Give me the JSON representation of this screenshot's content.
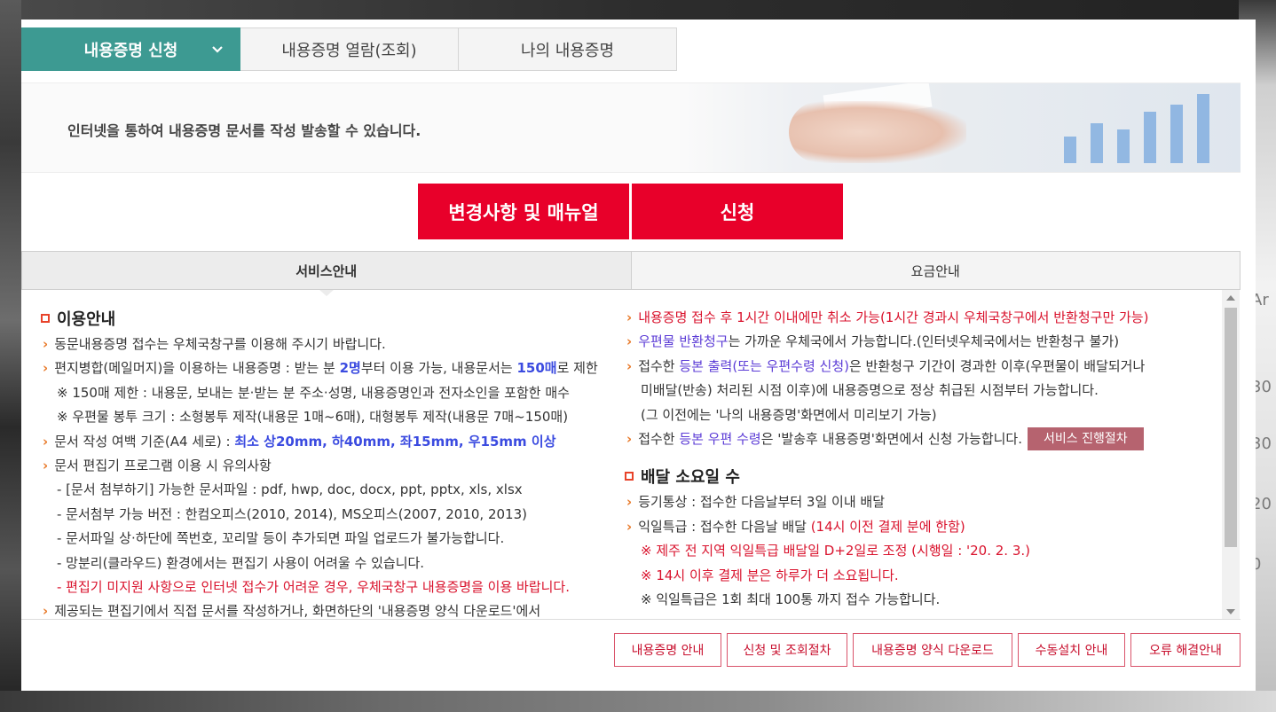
{
  "top_tabs": [
    {
      "label": "내용증명 신청"
    },
    {
      "label": "내용증명 열람(조회)"
    },
    {
      "label": "나의 내용증명"
    }
  ],
  "banner": {
    "text": "인터넷을 통하여 내용증명 문서를 작성 발송할 수 있습니다."
  },
  "actions": {
    "manual": "변경사항 및 매뉴얼",
    "apply": "신청"
  },
  "content_tabs": [
    {
      "label": "서비스안내"
    },
    {
      "label": "요금안내"
    }
  ],
  "left": {
    "title": "이용안내",
    "l1": "동문내용증명 접수는 우체국창구를 이용해 주시기 바랍니다.",
    "l2a": "편지병합(메일머지)을 이용하는 내용증명 : 받는 분 ",
    "l2b": "2명",
    "l2c": "부터 이용 가능, 내용문서는 ",
    "l2d": "150매",
    "l2e": "로 제한",
    "l3": "※ 150매 제한 : 내용문, 보내는 분·받는 분 주소·성명, 내용증명인과 전자소인을 포함한 매수",
    "l4": "※ 우편물 봉투 크기 : 소형봉투 제작(내용문 1매~6매), 대형봉투 제작(내용문 7매~150매)",
    "l5a": "문서 작성 여백 기준(A4 세로) : ",
    "l5b": "최소 상20mm, 하40mm, 좌15mm, 우15mm 이상",
    "l6": "문서 편집기 프로그램 이용 시 유의사항",
    "l7": "- [문서 첨부하기] 가능한 문서파일 : pdf, hwp, doc, docx, ppt, pptx, xls, xlsx",
    "l8": "- 문서첨부 가능 버전 : 한컴오피스(2010, 2014), MS오피스(2007, 2010, 2013)",
    "l9": "- 문서파일 상·하단에 쪽번호, 꼬리말 등이 추가되면 파일 업로드가 불가능합니다.",
    "l10": "- 망분리(클라우드) 환경에서는 편집기 사용이 어려울 수 있습니다.",
    "l11": "- 편집기 미지원 사항으로 인터넷 접수가 어려운 경우, 우체국창구 내용증명을 이용 바랍니다.",
    "l12": "제공되는 편집기에서 직접 문서를 작성하거나, 화면하단의 '내용증명 양식 다운로드'에서"
  },
  "right": {
    "r1": "내용증명 접수 후 1시간 이내에만 취소 가능(1시간 경과시 우체국창구에서 반환청구만 가능)",
    "r2a": "우편물 반환청구",
    "r2b": "는 가까운 우체국에서 가능합니다.(인터넷우체국에서는 반환청구 불가)",
    "r3a": "접수한 ",
    "r3b": "등본 출력(또는 우편수령 신청)",
    "r3c": "은 반환청구 기간이 경과한 이후(우편물이 배달되거나",
    "r4": "미배달(반송) 처리된 시점 이후)에 내용증명으로 정상 취급된 시점부터 가능합니다.",
    "r5": "(그 이전에는 '나의 내용증명'화면에서 미리보기 가능)",
    "r6a": "접수한 ",
    "r6b": "등본 우편 수령",
    "r6c": "은 '발송후 내용증명'화면에서 신청 가능합니다.",
    "r6btn": "서비스 진행절차",
    "title2": "배달 소요일 수",
    "d1": "등기통상 : 접수한 다음날부터 3일 이내 배달",
    "d2a": "익일특급 : 접수한 다음날 배달 ",
    "d2b": "(14시 이전 결제 분에 한함)",
    "d3": "※ 제주 전 지역 익일특급 배달일 D+2일로 조정 (시행일 : '20. 2. 3.)",
    "d4": "※ 14시 이후 결제 분은 하루가 더 소요됩니다.",
    "d5": "※ 익일특급은 1회 최대 100통 까지 접수 가능합니다."
  },
  "bottom_buttons": [
    {
      "label": "내용증명 안내"
    },
    {
      "label": "신청 및 조회절차"
    },
    {
      "label": "내용증명 양식 다운로드"
    },
    {
      "label": "수동설치 안내"
    },
    {
      "label": "오류 해결안내"
    }
  ],
  "background_marks": [
    "Ar",
    "30",
    "30",
    "20",
    "0"
  ],
  "colors": {
    "teal": "#3d9a92",
    "red": "#e8002a",
    "purple": "#b6636f"
  }
}
